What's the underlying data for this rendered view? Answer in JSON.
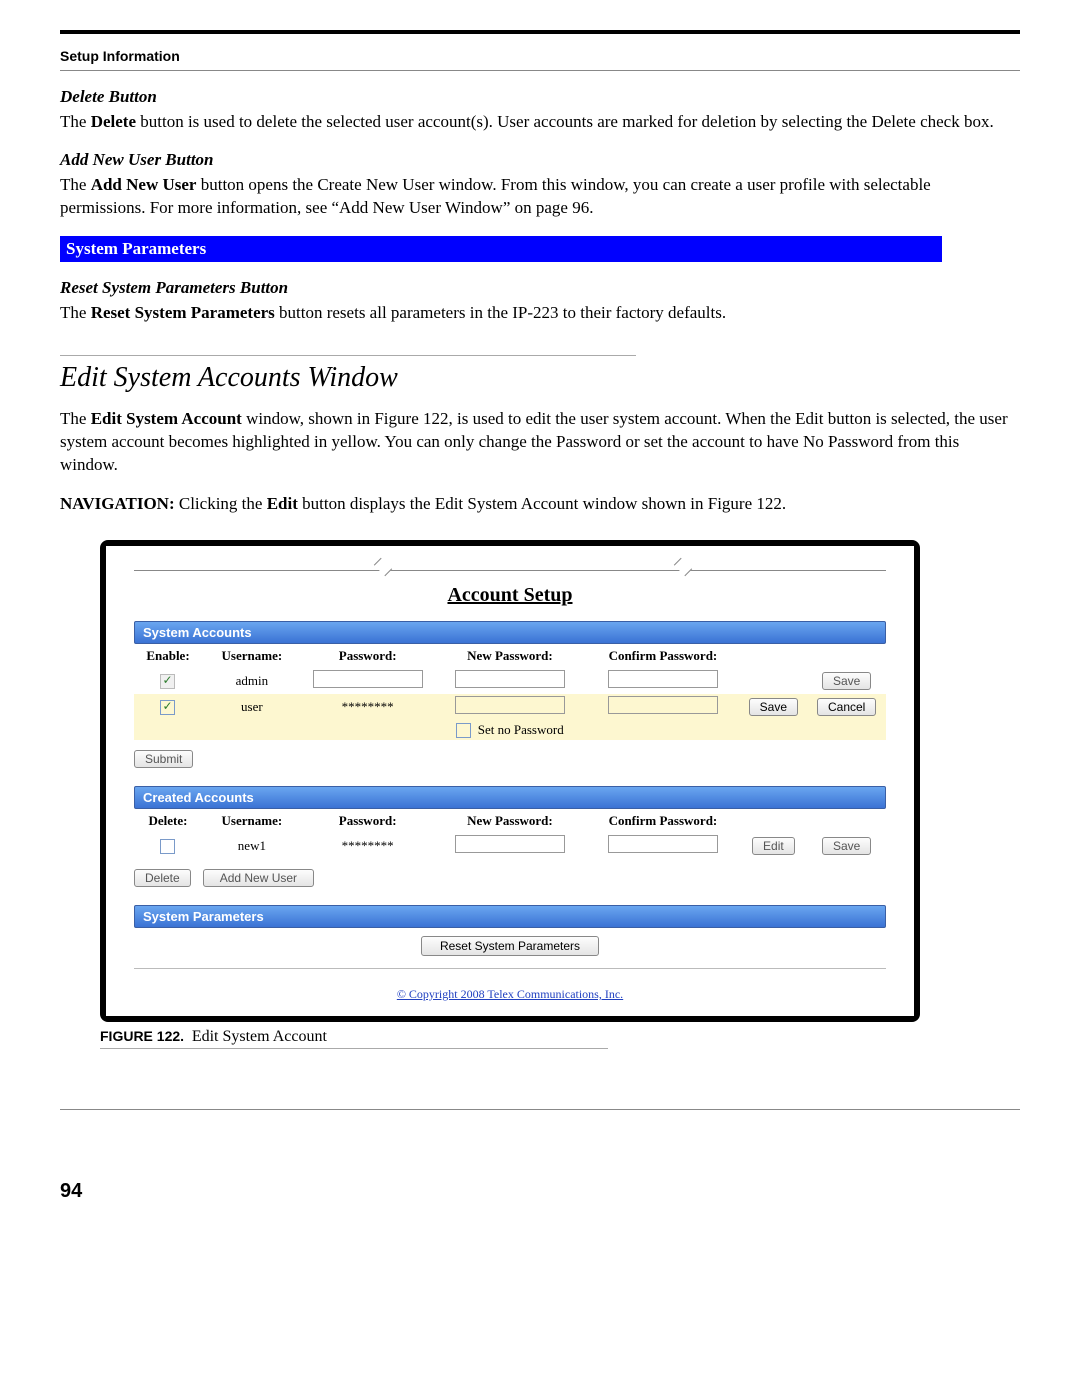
{
  "header": {
    "setup_info": "Setup Information"
  },
  "sections": {
    "delete_button": {
      "heading": "Delete Button",
      "para_prefix": "The ",
      "para_bold": "Delete",
      "para_rest": " button is used to delete the selected user account(s). User accounts are marked for deletion by selecting the Delete check box."
    },
    "add_new_user": {
      "heading": "Add New User Button",
      "para_prefix": "The ",
      "para_bold": "Add New User",
      "para_rest": " button opens the Create New User window. From this window, you can create a user profile with selectable permissions. For more information, see “Add New User Window” on page 96."
    },
    "sys_params_bar": "System Parameters",
    "reset_sys": {
      "heading": "Reset System Parameters Button",
      "para_prefix": "The ",
      "para_bold": "Reset System Parameters",
      "para_rest": " button resets all parameters in the IP-223 to their factory defaults."
    },
    "edit_window": {
      "title": "Edit System Accounts Window",
      "para1_prefix": "The ",
      "para1_bold": "Edit System Account",
      "para1_rest": " window, shown in Figure 122, is used to edit the user system account. When the Edit button is selected, the user system account becomes highlighted in yellow. You can only change the Password or set the account to have No Password from this window.",
      "nav_bold": "NAVIGATION:",
      "nav_mid1": "  Clicking the ",
      "nav_bold2": "Edit",
      "nav_rest": " button displays the Edit System Account window shown in Figure 122."
    }
  },
  "figure": {
    "title": "Account Setup",
    "sys_accounts_label": "System Accounts",
    "created_accounts_label": "Created Accounts",
    "sys_params_label": "System Parameters",
    "cols_sys": {
      "c1": "Enable:",
      "c2": "Username:",
      "c3": "Password:",
      "c4": "New Password:",
      "c5": "Confirm Password:"
    },
    "cols_created": {
      "c1": "Delete:",
      "c2": "Username:",
      "c3": "Password:",
      "c4": "New Password:",
      "c5": "Confirm Password:"
    },
    "rows_sys": {
      "r1": {
        "username": "admin",
        "password": "",
        "save": "Save"
      },
      "r2": {
        "username": "user",
        "password": "********",
        "save": "Save",
        "cancel": "Cancel"
      }
    },
    "set_no_pw": "Set no Password",
    "submit": "Submit",
    "rows_created": {
      "r1": {
        "username": "new1",
        "password": "********",
        "edit": "Edit",
        "save": "Save"
      }
    },
    "delete_btn": "Delete",
    "add_user_btn": "Add New User",
    "reset_btn": "Reset System Parameters",
    "copyright": "© Copyright 2008 Telex Communications, Inc.",
    "caption_bold": "FIGURE 122.",
    "caption_rest": "Edit System Account"
  },
  "page_number": "94"
}
